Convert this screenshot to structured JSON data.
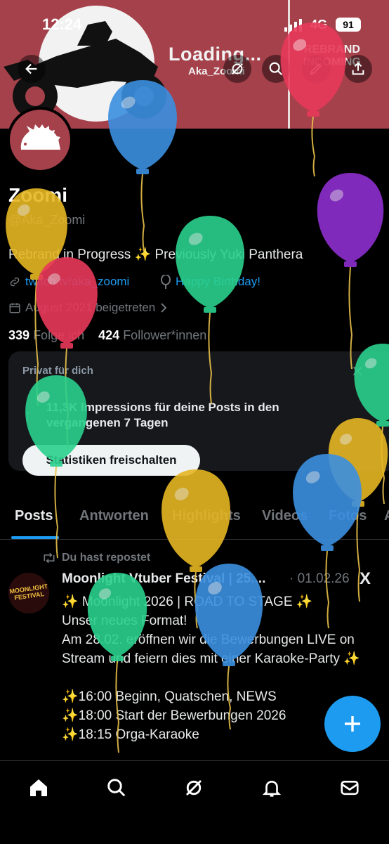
{
  "status_bar": {
    "time": "12:24",
    "network": "4G",
    "battery": "91"
  },
  "banner": {
    "loading_text": "Loading...",
    "aka_text": "Aka_Zoomi",
    "rebrand_line1": "REBRAND",
    "rebrand_line2": "INCOMING"
  },
  "header_icons": [
    "back-arrow-icon",
    "grok-icon",
    "search-icon",
    "edit-icon",
    "share-icon"
  ],
  "profile": {
    "name": "Zoomi",
    "handle": "@Aka_Zoomi",
    "bio": "Rebrand in Progress ✨ Previously Yuki Panthera",
    "link": "twitch.tv/aka_zoomi",
    "birthday": "Happy Birthday!",
    "joined": "August 2021 beigetreten",
    "following_count": "339",
    "following_label": "Folge ich",
    "followers_count": "424",
    "followers_label": "Follower*innen"
  },
  "private_card": {
    "label": "Privat für dich",
    "impressions": "11,3K Impressions für deine Posts in den vergangenen 7 Tagen",
    "button": "Statistiken freischalten"
  },
  "tabs": [
    "Posts",
    "Antworten",
    "Highlights",
    "Videos",
    "Fotos",
    "A"
  ],
  "post": {
    "repost_label": "Du hast repostet",
    "avatar_text": "MOONLIGHT FESTIVAL",
    "title": "Moonlight Vtuber Festival | 25....",
    "date": "· 01.02.26",
    "body": "✨ Moonlight 2026 | ROAD TO STAGE ✨\nUnser neues Format!\nAm 28.02. eröffnen wir die Bewerbungen LIVE on Stream und feiern dies mit einer Karaoke-Party ✨\n\n✨16:00 Beginn, Quatschen, NEWS\n✨18:00 Start der Bewerbungen 2026\n✨18:15  Orga-Karaoke"
  },
  "bottom_nav": [
    "home-icon",
    "search-icon",
    "grok-icon",
    "notifications-icon",
    "messages-icon"
  ],
  "balloon_colors": {
    "red": "#e8395a",
    "blue": "#3b8fe0",
    "green": "#2bd18d",
    "yellow": "#e6b623",
    "purple": "#8e2fd0"
  }
}
